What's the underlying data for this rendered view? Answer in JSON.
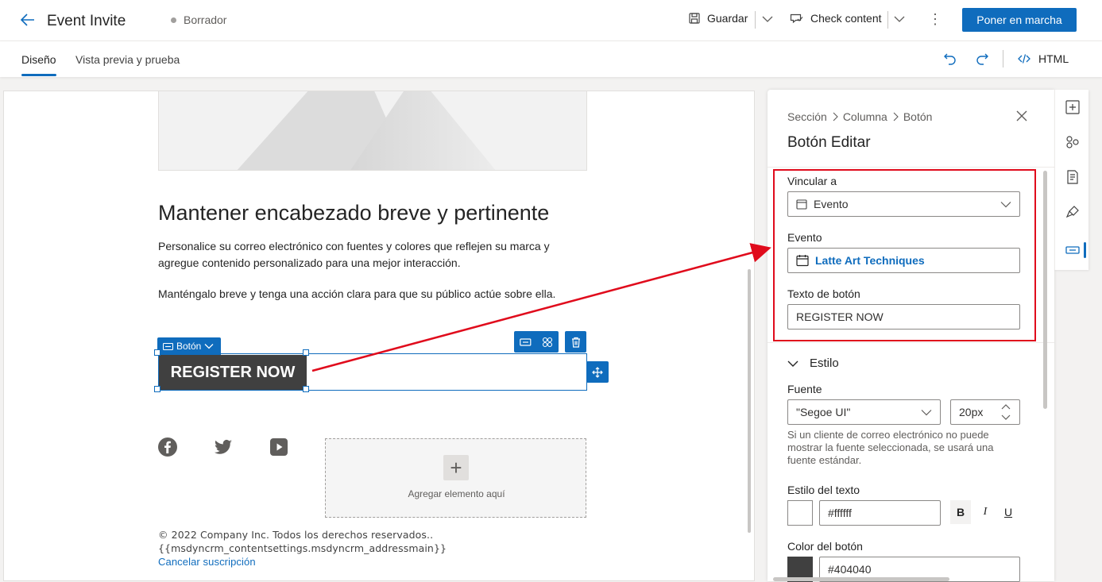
{
  "header": {
    "title": "Event Invite",
    "status": "Borrador",
    "save_label": "Guardar",
    "check_label": "Check content",
    "primary_label": "Poner en marcha"
  },
  "tabs": [
    {
      "label": "Diseño"
    },
    {
      "label": "Vista previa y prueba"
    }
  ],
  "toolbar": {
    "html_label": "HTML"
  },
  "canvas": {
    "headline": "Mantener encabezado breve y pertinente",
    "paragraph1_line1": "Personalice su correo electrónico con fuentes y colores que reflejen su marca y",
    "paragraph1_line2": "agregue contenido personalizado para una mejor interacción.",
    "paragraph2": "Manténgalo breve y tenga una acción clara para que su público actúe sobre ella.",
    "element_chip": "Botón",
    "button_text": "REGISTER NOW",
    "add_element": "Agregar elemento aquí",
    "footer_copyright": "© 2022 Company Inc. Todos los derechos reservados..",
    "footer_address": "{{msdyncrm_contentsettings.msdyncrm_addressmain}}",
    "footer_unsubscribe": "Cancelar suscripción"
  },
  "panel": {
    "breadcrumb": [
      "Sección",
      "Columna",
      "Botón"
    ],
    "title": "Botón Editar",
    "link_label": "Vincular a",
    "link_value": "Evento",
    "event_label": "Evento",
    "event_value": "Latte Art Techniques",
    "button_text_label": "Texto de botón",
    "button_text_value": "REGISTER NOW",
    "style_section": "Estilo",
    "font_label": "Fuente",
    "font_value": "\"Segoe UI\"",
    "font_size": "20px",
    "font_hint": "Si un cliente de correo electrónico no puede mostrar la fuente seleccionada, se usará una fuente estándar.",
    "text_style_label": "Estilo del texto",
    "text_color": "#ffffff",
    "bold": "B",
    "italic": "I",
    "underline": "U",
    "button_color_label": "Color del botón",
    "button_color": "#404040"
  },
  "colors": {
    "accent": "#0f6cbd",
    "highlight": "#e00b1c",
    "button_bg": "#404040"
  }
}
